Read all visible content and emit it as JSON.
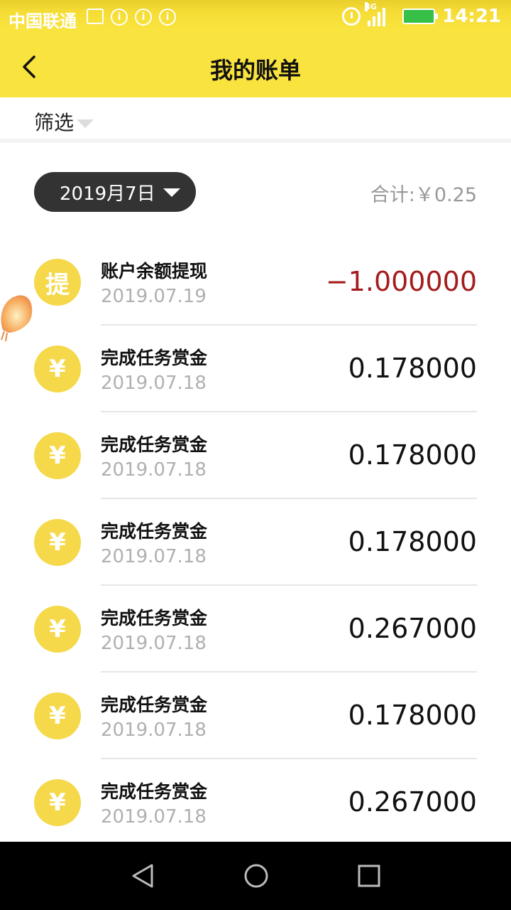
{
  "status_bar": {
    "carrier": "中国联通",
    "network": "4G",
    "time": "14:21"
  },
  "header": {
    "title": "我的账单"
  },
  "filter": {
    "label": "筛选"
  },
  "summary": {
    "date": "2019月7日",
    "total": "合计:￥0.25"
  },
  "transactions": [
    {
      "icon": "提",
      "title": "账户余额提现",
      "date": "2019.07.19",
      "amount": "−1.000000"
    },
    {
      "icon": "¥",
      "title": "完成任务赏金",
      "date": "2019.07.18",
      "amount": "0.178000"
    },
    {
      "icon": "¥",
      "title": "完成任务赏金",
      "date": "2019.07.18",
      "amount": "0.178000"
    },
    {
      "icon": "¥",
      "title": "完成任务赏金",
      "date": "2019.07.18",
      "amount": "0.178000"
    },
    {
      "icon": "¥",
      "title": "完成任务赏金",
      "date": "2019.07.18",
      "amount": "0.267000"
    },
    {
      "icon": "¥",
      "title": "完成任务赏金",
      "date": "2019.07.18",
      "amount": "0.178000"
    },
    {
      "icon": "¥",
      "title": "完成任务赏金",
      "date": "2019.07.18",
      "amount": "0.267000"
    }
  ],
  "colors": {
    "header_bg": "#f9e33e",
    "coin": "#f5d94a",
    "negative_amount": "#a51c1c",
    "date_pill": "#333333"
  }
}
